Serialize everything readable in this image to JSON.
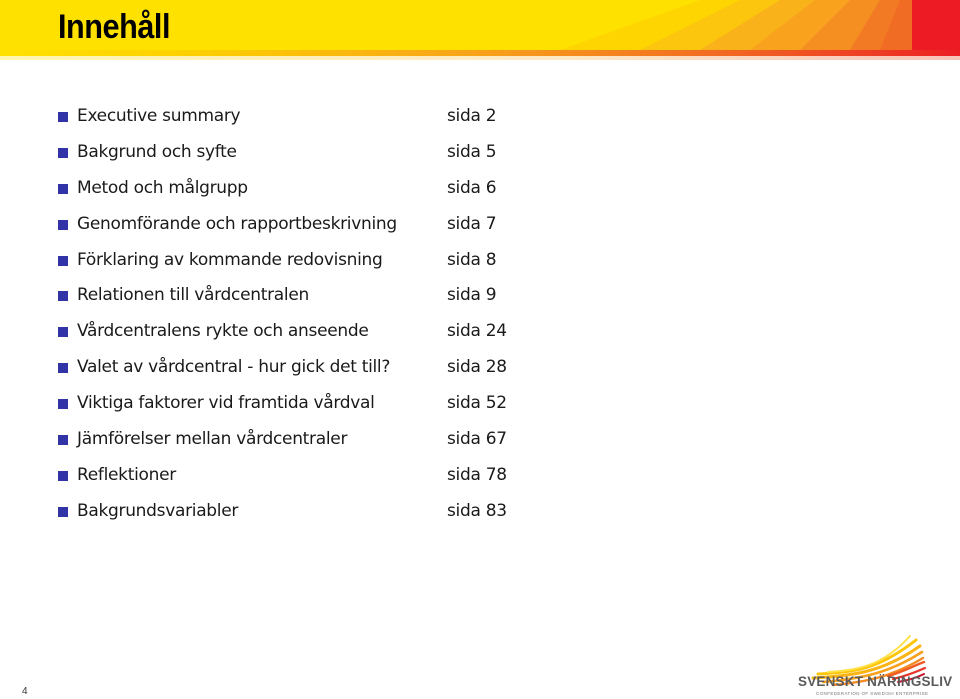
{
  "header": {
    "title": "Innehåll",
    "colors": {
      "yellow": "#ffe100",
      "orange": "#f26a22",
      "red": "#ed1c24"
    }
  },
  "toc": {
    "bullet_color": "#3333a8",
    "items": [
      {
        "label": "Executive summary",
        "page": "sida 2"
      },
      {
        "label": "Bakgrund och syfte",
        "page": "sida 5"
      },
      {
        "label": "Metod och målgrupp",
        "page": "sida 6"
      },
      {
        "label": "Genomförande och rapportbeskrivning",
        "page": "sida 7"
      },
      {
        "label": "Förklaring av kommande redovisning",
        "page": "sida 8"
      },
      {
        "label": "Relationen till vårdcentralen",
        "page": "sida 9"
      },
      {
        "label": "Vårdcentralens rykte och anseende",
        "page": "sida 24"
      },
      {
        "label": "Valet av vårdcentral - hur gick det till?",
        "page": "sida 28"
      },
      {
        "label": "Viktiga faktorer vid framtida vårdval",
        "page": "sida 52"
      },
      {
        "label": "Jämförelser mellan vårdcentraler",
        "page": "sida 67"
      },
      {
        "label": "Reflektioner",
        "page": "sida 78"
      },
      {
        "label": "Bakgrundsvariabler",
        "page": "sida 83"
      }
    ]
  },
  "footer": {
    "page_number": "4",
    "logo_name": "SVENSKT NÄRINGSLIV",
    "logo_tagline": "CONFEDERATION OF SWEDISH ENTERPRISE",
    "logo_icon": "wing-icon"
  }
}
